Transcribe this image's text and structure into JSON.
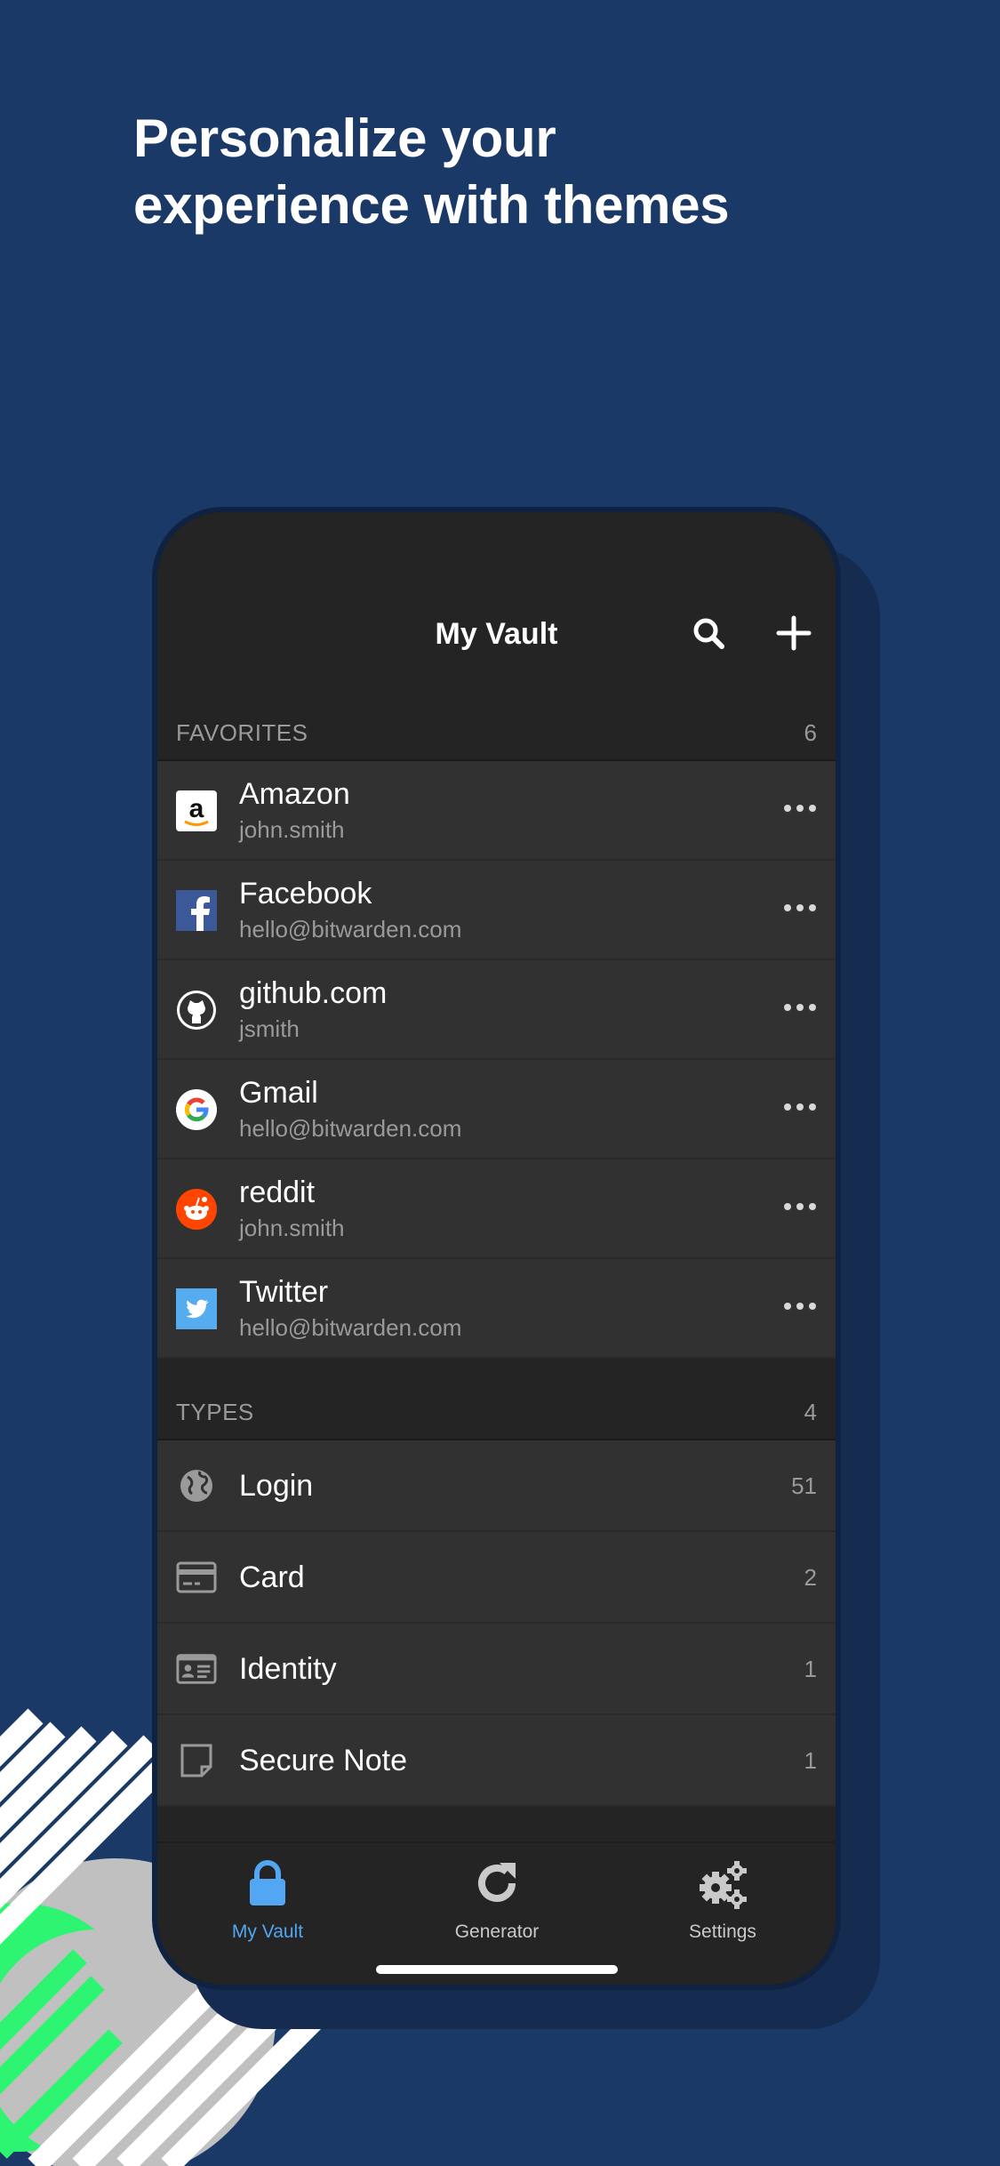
{
  "headline": {
    "line1": "Personalize your",
    "line2": "experience with themes"
  },
  "app": {
    "title": "My Vault",
    "colors": {
      "background": "#1b3966",
      "accent": "#52a6f2",
      "row": "#313131",
      "header": "#242424"
    }
  },
  "favorites": {
    "label": "FAVORITES",
    "count": "6",
    "items": [
      {
        "title": "Amazon",
        "subtitle": "john.smith",
        "icon": "amazon-icon"
      },
      {
        "title": "Facebook",
        "subtitle": "hello@bitwarden.com",
        "icon": "facebook-icon"
      },
      {
        "title": "github.com",
        "subtitle": "jsmith",
        "icon": "github-icon"
      },
      {
        "title": "Gmail",
        "subtitle": "hello@bitwarden.com",
        "icon": "google-icon"
      },
      {
        "title": "reddit",
        "subtitle": "john.smith",
        "icon": "reddit-icon"
      },
      {
        "title": "Twitter",
        "subtitle": "hello@bitwarden.com",
        "icon": "twitter-icon"
      }
    ]
  },
  "types": {
    "label": "TYPES",
    "count": "4",
    "items": [
      {
        "title": "Login",
        "count": "51",
        "icon": "globe-icon"
      },
      {
        "title": "Card",
        "count": "2",
        "icon": "credit-card-icon"
      },
      {
        "title": "Identity",
        "count": "1",
        "icon": "id-card-icon"
      },
      {
        "title": "Secure Note",
        "count": "1",
        "icon": "note-icon"
      }
    ]
  },
  "tabs": [
    {
      "label": "My Vault",
      "icon": "lock-icon",
      "active": true
    },
    {
      "label": "Generator",
      "icon": "refresh-icon",
      "active": false
    },
    {
      "label": "Settings",
      "icon": "gears-icon",
      "active": false
    }
  ]
}
